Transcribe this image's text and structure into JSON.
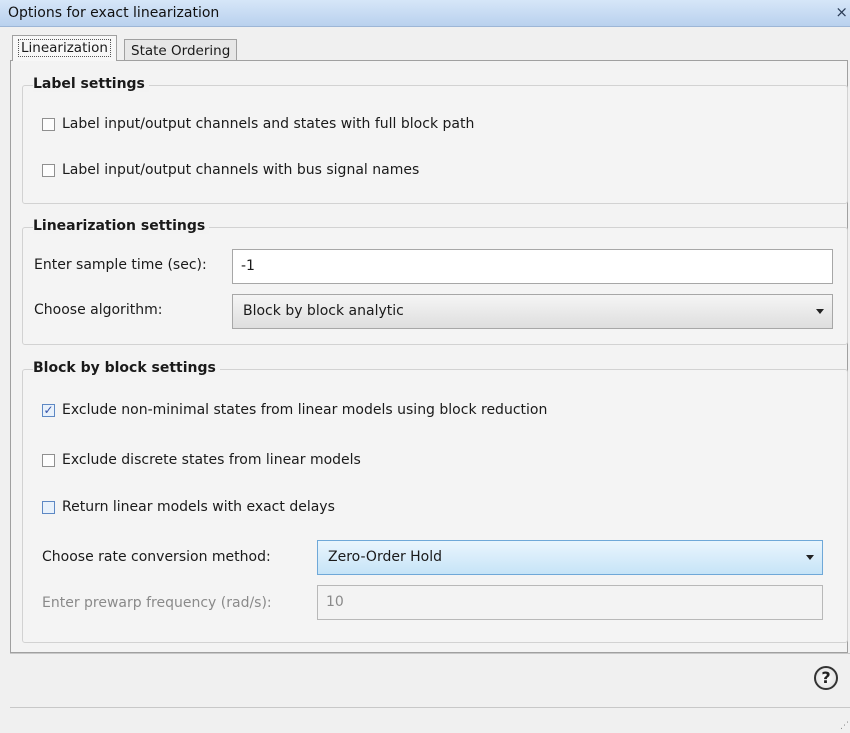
{
  "window": {
    "title": "Options for exact linearization",
    "close_glyph": "×"
  },
  "tabs": [
    {
      "label": "Linearization",
      "active": true
    },
    {
      "label": "State Ordering",
      "active": false
    }
  ],
  "label_settings": {
    "title": "Label settings",
    "items": [
      {
        "label": "Label input/output channels and states with full block path",
        "checked": false
      },
      {
        "label": "Label input/output channels with bus signal names",
        "checked": false
      }
    ]
  },
  "linearization_settings": {
    "title": "Linearization settings",
    "sample_time_label": "Enter sample time (sec):",
    "sample_time_value": "-1",
    "algorithm_label": "Choose algorithm:",
    "algorithm_value": "Block by block analytic"
  },
  "block_settings": {
    "title": "Block by block settings",
    "items": [
      {
        "label": "Exclude non-minimal states from linear models using block reduction",
        "checked": true
      },
      {
        "label": "Exclude discrete states from linear models",
        "checked": false
      },
      {
        "label": "Return linear models with exact delays",
        "checked": false
      }
    ],
    "rate_label": "Choose rate conversion method:",
    "rate_value": "Zero-Order Hold",
    "prewarp_label": "Enter prewarp frequency (rad/s):",
    "prewarp_value": "10"
  },
  "help": {
    "glyph": "?",
    "icon": "help-icon"
  },
  "colors": {
    "titlebar": "#c9dcf3",
    "accent": "#6fa8d8"
  }
}
